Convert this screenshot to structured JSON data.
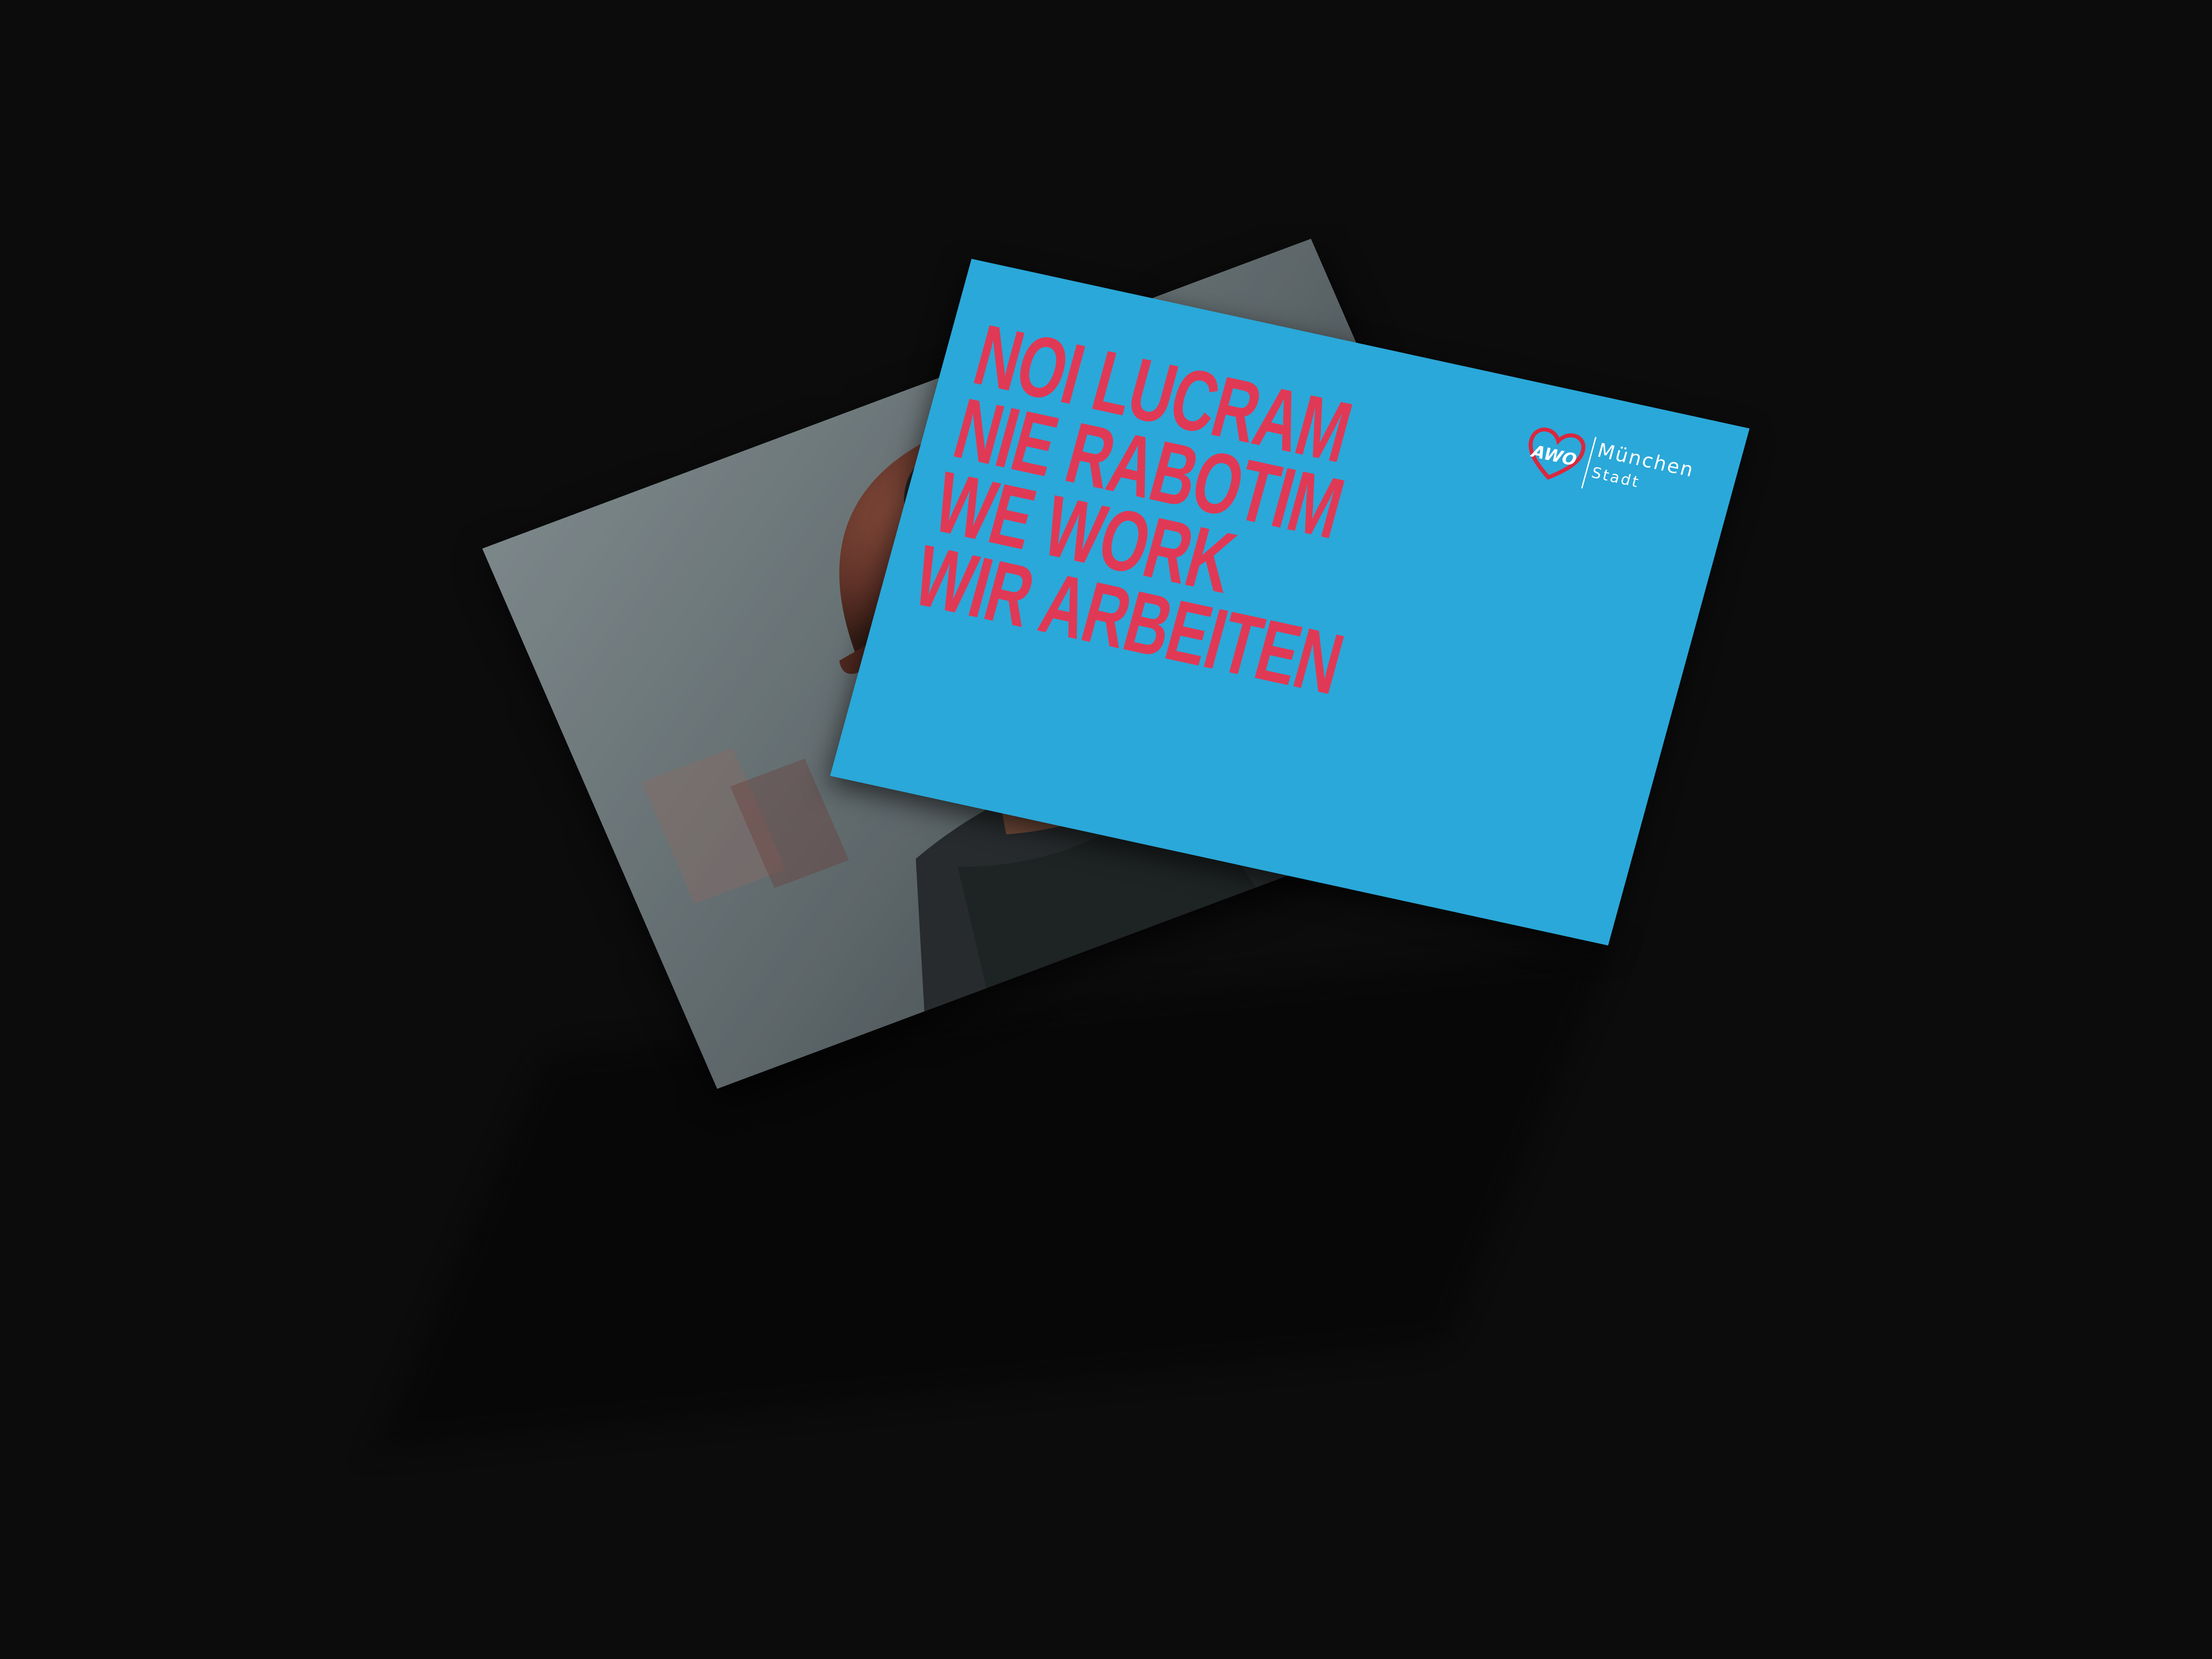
{
  "postcard": {
    "headline_lines": [
      "NOI LUCRAM",
      "NIE RABOTIM",
      "WE WORK",
      "WIR ARBEITEN"
    ],
    "logo": {
      "brand": "AWO",
      "city": "München",
      "sub": "Stadt"
    }
  },
  "photo": {
    "subject": "miner-portrait-icon"
  },
  "colors": {
    "background": "#0c0c0c",
    "postcard_blue": "#2aa8d9",
    "headline_red": "#e03955",
    "logo_red": "#d8283f",
    "logo_white": "#ffffff"
  }
}
